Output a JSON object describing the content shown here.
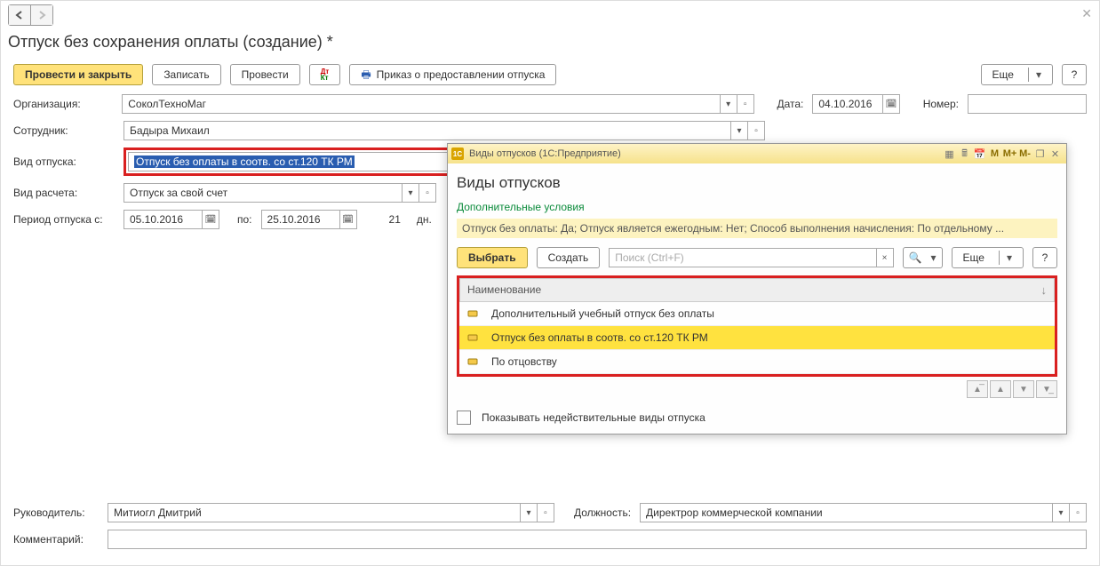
{
  "page": {
    "title": "Отпуск без сохранения оплаты (создание) *"
  },
  "toolbar": {
    "post_close": "Провести и закрыть",
    "save": "Записать",
    "post": "Провести",
    "order": "Приказ о предоставлении отпуска",
    "more": "Еще",
    "help": "?"
  },
  "labels": {
    "org": "Организация:",
    "date": "Дата:",
    "number": "Номер:",
    "employee": "Сотрудник:",
    "vac_type": "Вид отпуска:",
    "calc_type": "Вид расчета:",
    "period_from": "Период отпуска с:",
    "to": "по:",
    "days_unit": "дн.",
    "manager": "Руководитель:",
    "position": "Должность:",
    "comment": "Комментарий:"
  },
  "values": {
    "org": "СоколТехноМаг",
    "date": "04.10.2016",
    "number": "",
    "employee": "Бадыра Михаил",
    "vac_type": "Отпуск без оплаты в соотв. со ст.120 ТК РМ",
    "calc_type": "Отпуск за свой счет",
    "period_from": "05.10.2016",
    "period_to": "25.10.2016",
    "days": "21",
    "manager": "Митиогл Дмитрий",
    "position": "Директрор коммерческой компании",
    "comment": ""
  },
  "popup": {
    "app_title": "Виды отпусков  (1С:Предприятие)",
    "title": "Виды отпусков",
    "cond_label": "Дополнительные условия",
    "cond_text": "Отпуск без оплаты: Да; Отпуск является ежегодным: Нет; Способ выполнения начисления: По отдельному ...",
    "select": "Выбрать",
    "create": "Создать",
    "search_ph": "Поиск (Ctrl+F)",
    "more": "Еще",
    "help": "?",
    "col_name": "Наименование",
    "rows": [
      {
        "label": "Дополнительный учебный отпуск без оплаты",
        "selected": false
      },
      {
        "label": "Отпуск без оплаты в соотв. со ст.120 ТК РМ",
        "selected": true
      },
      {
        "label": "По отцовству",
        "selected": false
      }
    ],
    "show_inactive": "Показывать недействительные виды отпуска",
    "titlebar_icons": {
      "m": "M",
      "mp": "M+",
      "mm": "M-"
    }
  }
}
